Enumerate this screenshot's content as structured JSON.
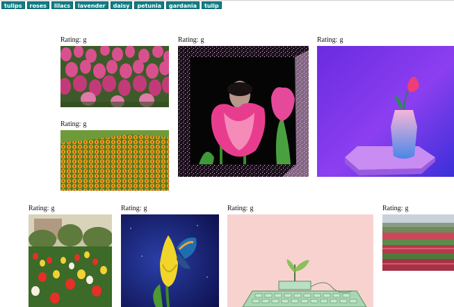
{
  "tags": [
    "tulips",
    "roses",
    "lilacs",
    "lavender",
    "daisy",
    "petunia",
    "gardania",
    "tulip"
  ],
  "rating_label": "Rating:",
  "cards": [
    {
      "rating": "g",
      "image": "pink-tulip-field-photo"
    },
    {
      "rating": "g",
      "image": "yellow-tulip-field-photo"
    },
    {
      "rating": "g",
      "image": "pink-tulips-with-mask-art"
    },
    {
      "rating": "g",
      "image": "tulip-in-vase-render"
    },
    {
      "rating": "g",
      "image": "mixed-tulips-park-photo"
    },
    {
      "rating": "g",
      "image": "butterfly-on-yellow-tulip-art"
    },
    {
      "rating": "g",
      "image": "sprout-on-keyboard-illustration"
    },
    {
      "rating": "g",
      "image": "tulip-fields-landscape-photo"
    }
  ],
  "colors": {
    "tag_bg": "#0f7e86",
    "tag_text": "#ffffff"
  }
}
